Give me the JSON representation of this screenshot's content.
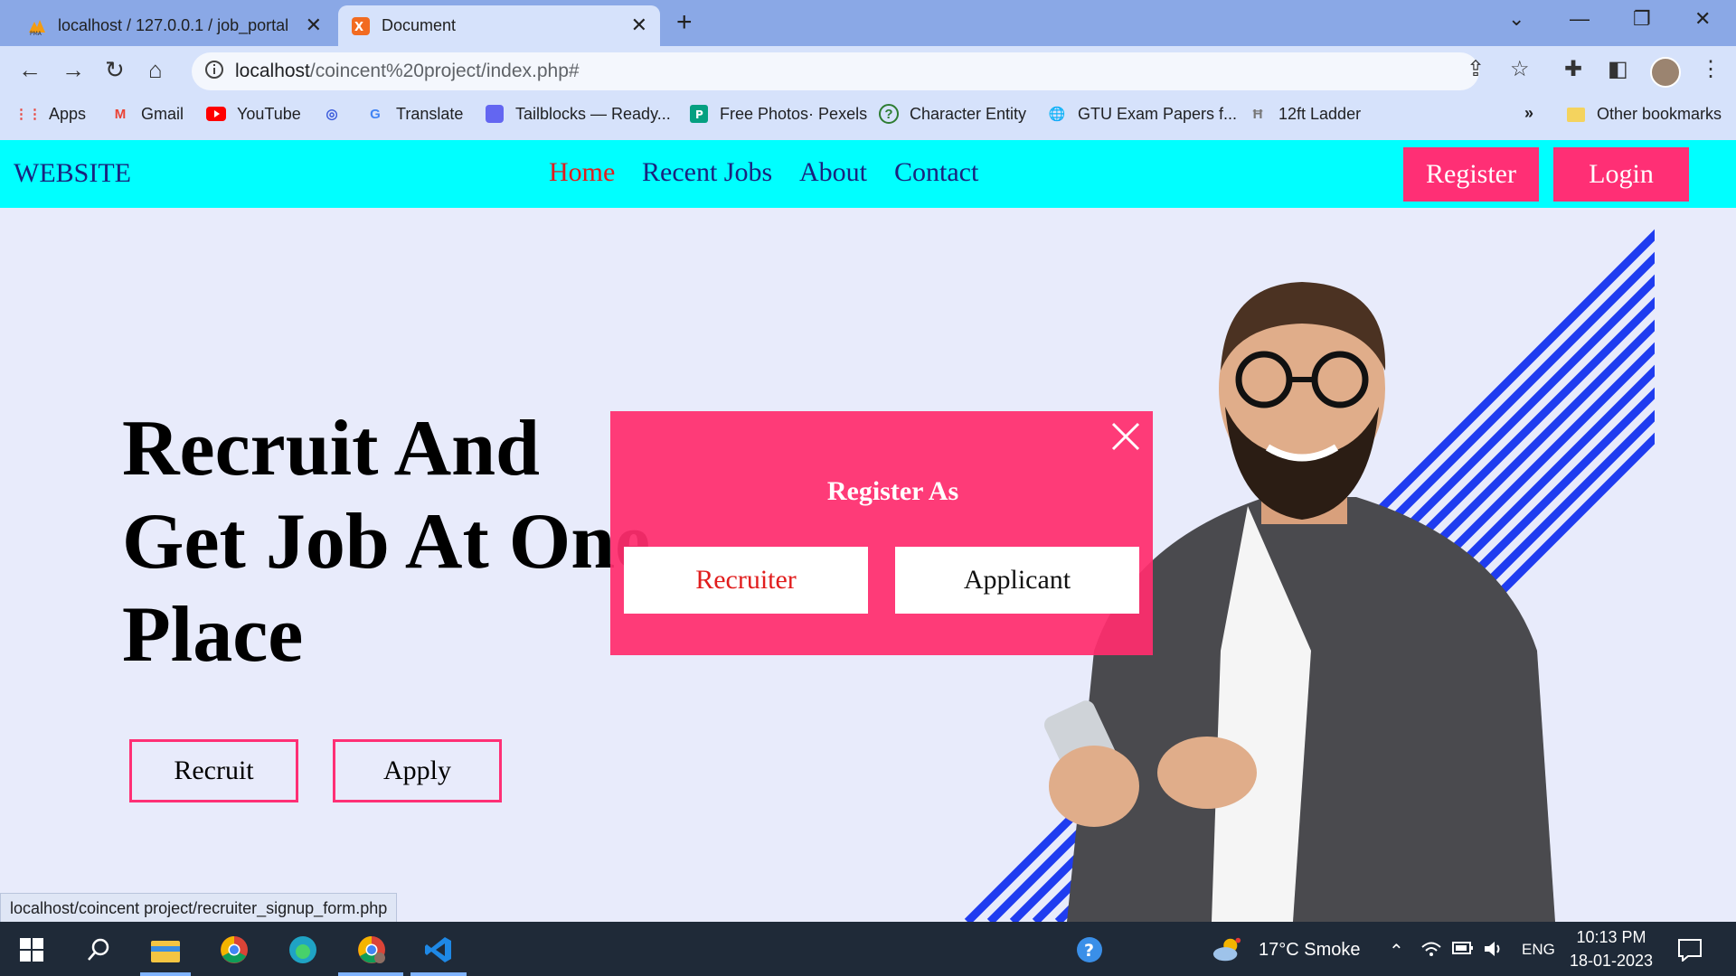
{
  "browser": {
    "tabs": [
      {
        "title": "localhost / 127.0.0.1 / job_portal",
        "active": false
      },
      {
        "title": "Document",
        "active": true
      }
    ],
    "url_host": "localhost",
    "url_path": "/coincent%20project/index.php#",
    "bookmarks": [
      "Apps",
      "Gmail",
      "YouTube",
      "Translate",
      "Tailblocks — Ready...",
      "Free Photos· Pexels",
      "Character Entity",
      "GTU Exam Papers f...",
      "12ft Ladder"
    ],
    "more_bookmarks": "»",
    "other_bookmarks": "Other bookmarks"
  },
  "site": {
    "brand": "WEBSITE",
    "nav": [
      "Home",
      "Recent Jobs",
      "About",
      "Contact"
    ],
    "register_label": "Register",
    "login_label": "Login",
    "hero_lines": [
      "Recruit And",
      "Get Job At One",
      "Place"
    ],
    "recruit_label": "Recruit",
    "apply_label": "Apply"
  },
  "modal": {
    "title": "Register As",
    "recruiter_label": "Recruiter",
    "applicant_label": "Applicant"
  },
  "status_url": "localhost/coincent project/recruiter_signup_form.php",
  "taskbar": {
    "weather": "17°C  Smoke",
    "language": "ENG",
    "time": "10:13 PM",
    "date": "18-01-2023"
  },
  "colors": {
    "header_bg": "#00ffff",
    "accent_pink": "#ff2f75",
    "nav_text": "#1a237e",
    "active_link": "#e11d1d",
    "stripe_blue": "#1f3cf0"
  }
}
